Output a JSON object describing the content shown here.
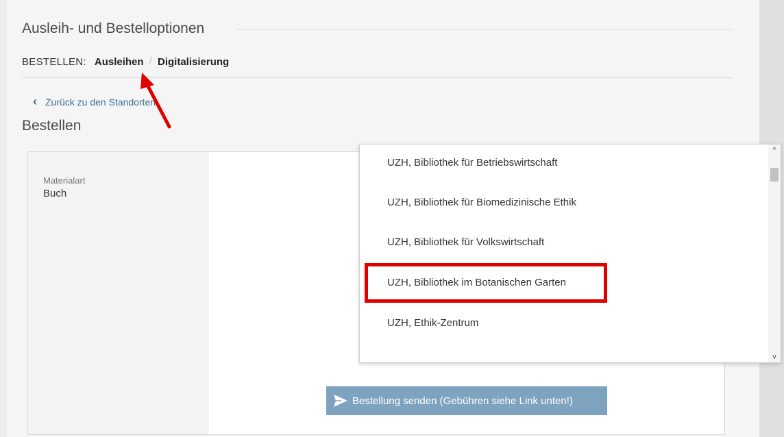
{
  "header": {
    "title": "Ausleih- und Bestelloptionen",
    "order_label": "BESTELLEN:",
    "tabs": [
      {
        "label": "Ausleihen"
      },
      {
        "label": "Digitalisierung"
      }
    ]
  },
  "back_link": {
    "label": "Zurück zu den Standorten",
    "icon": "chevron-left-icon"
  },
  "section": {
    "title": "Bestellen"
  },
  "form": {
    "material_label": "Materialart",
    "material_value": "Buch",
    "send_button": "Bestellung senden (Gebühren siehe Link unten!)",
    "send_icon": "paper-plane-icon"
  },
  "dropdown": {
    "options": [
      {
        "label": "UZH, Bibliothek für Betriebswirtschaft"
      },
      {
        "label": "UZH, Bibliothek für Biomedizinische Ethik"
      },
      {
        "label": "UZH, Bibliothek für Volkswirtschaft"
      },
      {
        "label": "UZH, Bibliothek im Botanischen Garten"
      },
      {
        "label": "UZH, Ethik-Zentrum"
      }
    ],
    "highlighted_index": 3
  },
  "annotations": {
    "arrow_color": "#e00000",
    "highlight_color": "#e00000"
  }
}
